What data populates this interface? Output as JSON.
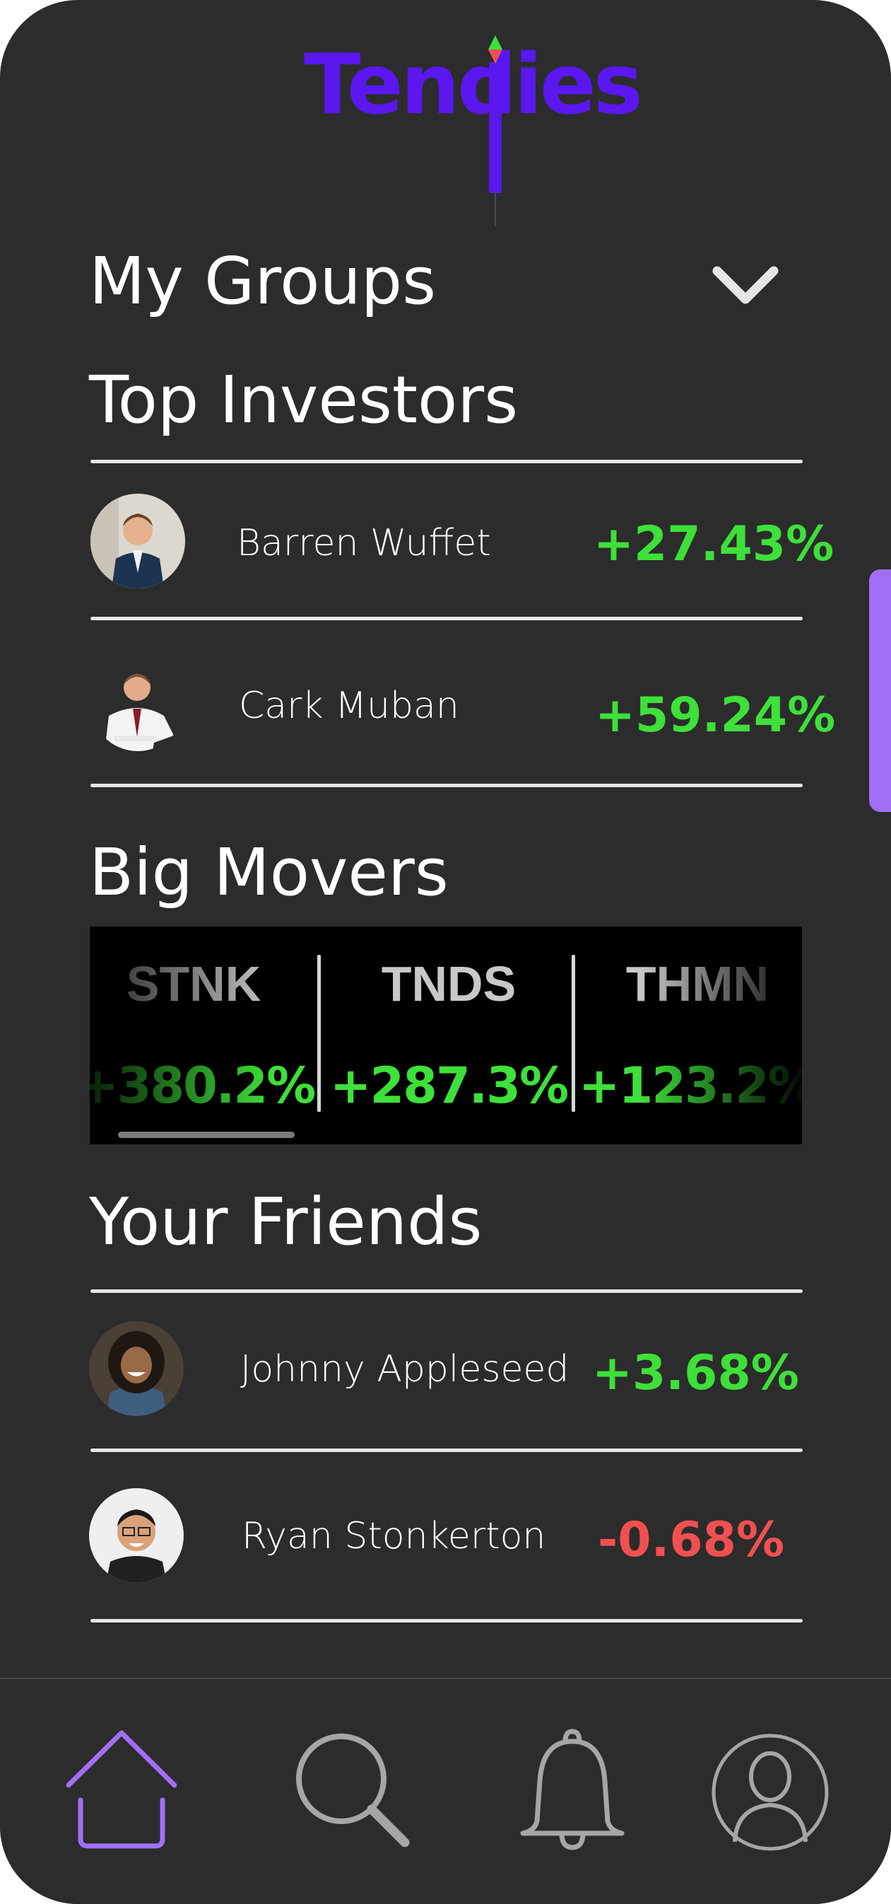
{
  "app": {
    "logo_text": "Tendies"
  },
  "sections": {
    "groups_title": "My Groups",
    "top_investors_title": "Top Investors",
    "big_movers_title": "Big Movers",
    "friends_title": "Your Friends"
  },
  "top_investors": [
    {
      "name": "Barren Wuffet",
      "change": "+27.43%"
    },
    {
      "name": "Cark Muban",
      "change": "+59.24%"
    }
  ],
  "big_movers": [
    {
      "ticker": "STNK",
      "change": "+380.2%"
    },
    {
      "ticker": "TNDS",
      "change": "+287.3%"
    },
    {
      "ticker": "THMN",
      "change": "+123.2%"
    }
  ],
  "friends": [
    {
      "name": "Johnny Appleseed",
      "change": "+3.68%"
    },
    {
      "name": "Ryan Stonkerton",
      "change": "-0.68%"
    }
  ],
  "nav": {
    "items": [
      {
        "icon": "home-icon",
        "active": true
      },
      {
        "icon": "search-icon",
        "active": false
      },
      {
        "icon": "bell-icon",
        "active": false
      },
      {
        "icon": "profile-icon",
        "active": false
      }
    ]
  },
  "colors": {
    "background": "#2c2c2c",
    "brand": "#5a17ee",
    "accent": "#a16ff5",
    "positive": "#3ee03a",
    "negative": "#f25050"
  }
}
